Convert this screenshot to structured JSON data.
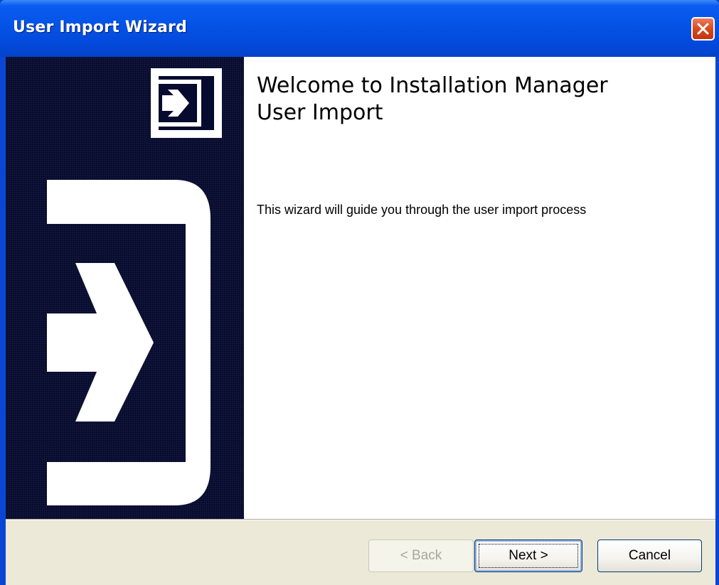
{
  "window": {
    "title": "User Import Wizard",
    "close_icon": "close-icon"
  },
  "banner": {
    "small_icon": "import-arrow-icon",
    "large_graphic": "import-arrow-large-icon"
  },
  "content": {
    "title_line1": "Welcome to Installation Manager",
    "title_line2": "User Import",
    "description": "This wizard will guide you through the user import process"
  },
  "buttons": {
    "back": "< Back",
    "back_enabled": false,
    "next": "Next >",
    "cancel": "Cancel"
  },
  "colors": {
    "titlebar": "#0453e6",
    "banner_bg": "#050a2e",
    "button_bar": "#ece9d8",
    "close_button": "#d9491f"
  }
}
